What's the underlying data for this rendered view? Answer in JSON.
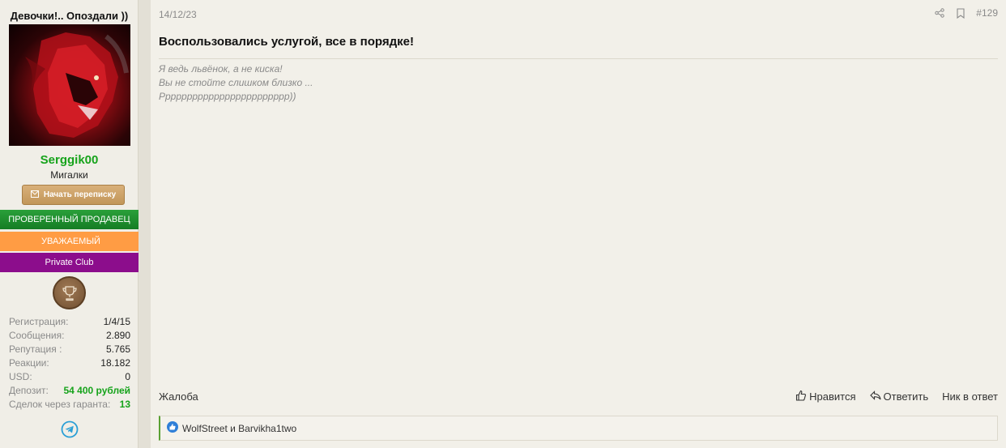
{
  "sidebar": {
    "user_title": "Девочки!.. Опоздали ))",
    "username": "Serggik00",
    "role": "Мигалки",
    "message_button": "Начать переписку",
    "banners": [
      {
        "label": "ПРОВЕРЕННЫЙ ПРОДАВЕЦ",
        "color": "#1f8f2e"
      },
      {
        "label": "УВАЖАЕМЫЙ",
        "color": "#ff9c44"
      },
      {
        "label": "Private Club",
        "color": "#8c0d8c"
      }
    ],
    "stats": [
      {
        "key": "Регистрация:",
        "value": "1/4/15"
      },
      {
        "key": "Сообщения:",
        "value": "2.890"
      },
      {
        "key": "Репутация :",
        "value": "5.765"
      },
      {
        "key": "Реакции:",
        "value": "18.182"
      },
      {
        "key": "USD:",
        "value": "0"
      },
      {
        "key": "Депозит:",
        "value": "54 400 рублей"
      },
      {
        "key": "Сделок через гаранта:",
        "value": "13"
      }
    ]
  },
  "post": {
    "date": "14/12/23",
    "number": "#129",
    "title": "Воспользовались услугой, все в порядке!",
    "signature": [
      "Я ведь львёнок, а не киска!",
      "Вы не стойте слишком близко ...",
      "Рррррррррррррррррррррррр))"
    ],
    "footer": {
      "report": "Жалоба",
      "like": "Нравится",
      "reply": "Ответить",
      "nick": "Ник в ответ"
    },
    "reactions_text": "WolfStreet и Barvikha1two"
  },
  "colors": {
    "accent_green": "#16a31b",
    "button_gold": "#c29659",
    "reaction_blue": "#2f7fd8"
  }
}
